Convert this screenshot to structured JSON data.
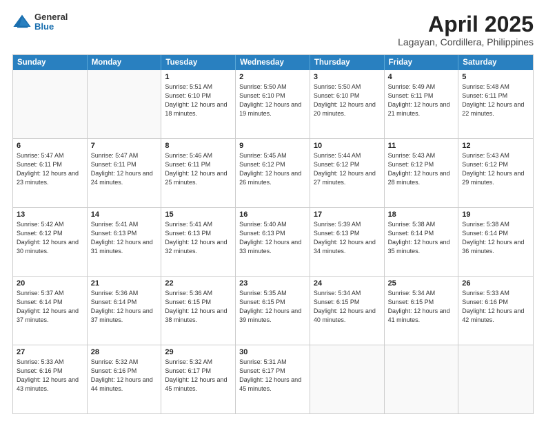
{
  "logo": {
    "general": "General",
    "blue": "Blue"
  },
  "title": "April 2025",
  "subtitle": "Lagayan, Cordillera, Philippines",
  "days": [
    "Sunday",
    "Monday",
    "Tuesday",
    "Wednesday",
    "Thursday",
    "Friday",
    "Saturday"
  ],
  "weeks": [
    [
      {
        "day": "",
        "info": ""
      },
      {
        "day": "",
        "info": ""
      },
      {
        "day": "1",
        "info": "Sunrise: 5:51 AM\nSunset: 6:10 PM\nDaylight: 12 hours and 18 minutes."
      },
      {
        "day": "2",
        "info": "Sunrise: 5:50 AM\nSunset: 6:10 PM\nDaylight: 12 hours and 19 minutes."
      },
      {
        "day": "3",
        "info": "Sunrise: 5:50 AM\nSunset: 6:10 PM\nDaylight: 12 hours and 20 minutes."
      },
      {
        "day": "4",
        "info": "Sunrise: 5:49 AM\nSunset: 6:11 PM\nDaylight: 12 hours and 21 minutes."
      },
      {
        "day": "5",
        "info": "Sunrise: 5:48 AM\nSunset: 6:11 PM\nDaylight: 12 hours and 22 minutes."
      }
    ],
    [
      {
        "day": "6",
        "info": "Sunrise: 5:47 AM\nSunset: 6:11 PM\nDaylight: 12 hours and 23 minutes."
      },
      {
        "day": "7",
        "info": "Sunrise: 5:47 AM\nSunset: 6:11 PM\nDaylight: 12 hours and 24 minutes."
      },
      {
        "day": "8",
        "info": "Sunrise: 5:46 AM\nSunset: 6:11 PM\nDaylight: 12 hours and 25 minutes."
      },
      {
        "day": "9",
        "info": "Sunrise: 5:45 AM\nSunset: 6:12 PM\nDaylight: 12 hours and 26 minutes."
      },
      {
        "day": "10",
        "info": "Sunrise: 5:44 AM\nSunset: 6:12 PM\nDaylight: 12 hours and 27 minutes."
      },
      {
        "day": "11",
        "info": "Sunrise: 5:43 AM\nSunset: 6:12 PM\nDaylight: 12 hours and 28 minutes."
      },
      {
        "day": "12",
        "info": "Sunrise: 5:43 AM\nSunset: 6:12 PM\nDaylight: 12 hours and 29 minutes."
      }
    ],
    [
      {
        "day": "13",
        "info": "Sunrise: 5:42 AM\nSunset: 6:12 PM\nDaylight: 12 hours and 30 minutes."
      },
      {
        "day": "14",
        "info": "Sunrise: 5:41 AM\nSunset: 6:13 PM\nDaylight: 12 hours and 31 minutes."
      },
      {
        "day": "15",
        "info": "Sunrise: 5:41 AM\nSunset: 6:13 PM\nDaylight: 12 hours and 32 minutes."
      },
      {
        "day": "16",
        "info": "Sunrise: 5:40 AM\nSunset: 6:13 PM\nDaylight: 12 hours and 33 minutes."
      },
      {
        "day": "17",
        "info": "Sunrise: 5:39 AM\nSunset: 6:13 PM\nDaylight: 12 hours and 34 minutes."
      },
      {
        "day": "18",
        "info": "Sunrise: 5:38 AM\nSunset: 6:14 PM\nDaylight: 12 hours and 35 minutes."
      },
      {
        "day": "19",
        "info": "Sunrise: 5:38 AM\nSunset: 6:14 PM\nDaylight: 12 hours and 36 minutes."
      }
    ],
    [
      {
        "day": "20",
        "info": "Sunrise: 5:37 AM\nSunset: 6:14 PM\nDaylight: 12 hours and 37 minutes."
      },
      {
        "day": "21",
        "info": "Sunrise: 5:36 AM\nSunset: 6:14 PM\nDaylight: 12 hours and 37 minutes."
      },
      {
        "day": "22",
        "info": "Sunrise: 5:36 AM\nSunset: 6:15 PM\nDaylight: 12 hours and 38 minutes."
      },
      {
        "day": "23",
        "info": "Sunrise: 5:35 AM\nSunset: 6:15 PM\nDaylight: 12 hours and 39 minutes."
      },
      {
        "day": "24",
        "info": "Sunrise: 5:34 AM\nSunset: 6:15 PM\nDaylight: 12 hours and 40 minutes."
      },
      {
        "day": "25",
        "info": "Sunrise: 5:34 AM\nSunset: 6:15 PM\nDaylight: 12 hours and 41 minutes."
      },
      {
        "day": "26",
        "info": "Sunrise: 5:33 AM\nSunset: 6:16 PM\nDaylight: 12 hours and 42 minutes."
      }
    ],
    [
      {
        "day": "27",
        "info": "Sunrise: 5:33 AM\nSunset: 6:16 PM\nDaylight: 12 hours and 43 minutes."
      },
      {
        "day": "28",
        "info": "Sunrise: 5:32 AM\nSunset: 6:16 PM\nDaylight: 12 hours and 44 minutes."
      },
      {
        "day": "29",
        "info": "Sunrise: 5:32 AM\nSunset: 6:17 PM\nDaylight: 12 hours and 45 minutes."
      },
      {
        "day": "30",
        "info": "Sunrise: 5:31 AM\nSunset: 6:17 PM\nDaylight: 12 hours and 45 minutes."
      },
      {
        "day": "",
        "info": ""
      },
      {
        "day": "",
        "info": ""
      },
      {
        "day": "",
        "info": ""
      }
    ]
  ]
}
